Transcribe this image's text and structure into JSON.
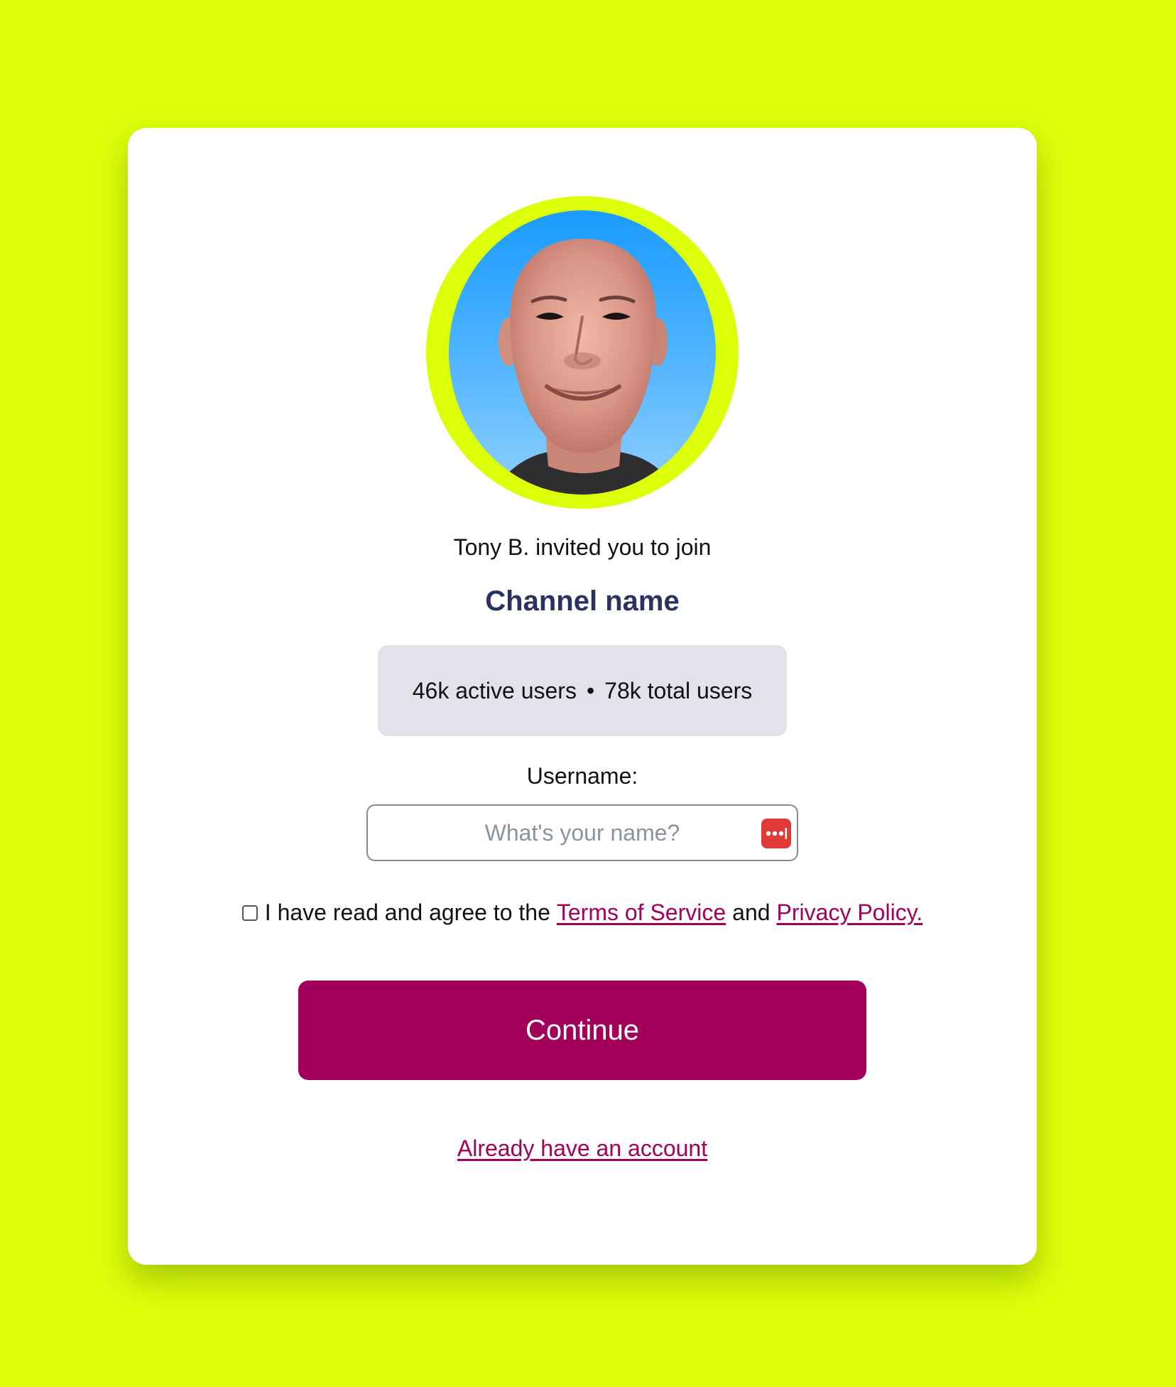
{
  "invite": {
    "avatar_icon": "user-photo",
    "inviter_text": "Tony B. invited you to join",
    "channel_name": "Channel name"
  },
  "stats": {
    "active": "46k active users",
    "separator": "•",
    "total": "78k total users"
  },
  "form": {
    "username_label": "Username:",
    "username_placeholder": "What's your name?",
    "username_value": "",
    "password_manager_icon": "password-manager-key-icon",
    "terms_prefix": "I have read and agree to the",
    "terms_link": "Terms of Service",
    "terms_and": "and",
    "privacy_link": "Privacy Policy.",
    "terms_checked": false,
    "continue_label": "Continue",
    "login_link": "Already have an account"
  },
  "colors": {
    "background": "#dcff0a",
    "card": "#ffffff",
    "accent": "#a3005c",
    "title": "#2b3262",
    "stats_box": "#e1e2ea",
    "password_icon": "#e03a36"
  }
}
